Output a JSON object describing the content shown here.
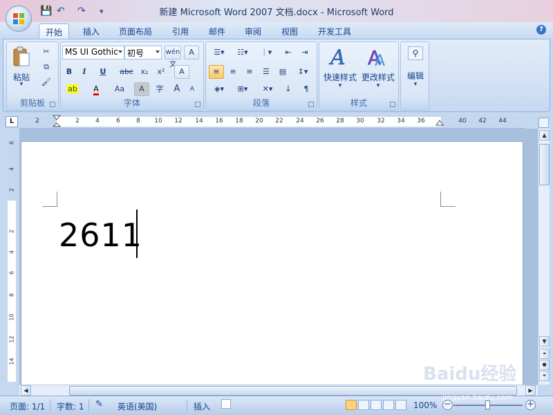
{
  "window": {
    "title": "新建 Microsoft Word 2007 文档.docx - Microsoft Word"
  },
  "qat": {
    "save": "💾",
    "undo": "↶",
    "redo": "↷",
    "customize": "▾"
  },
  "tabs": [
    "开始",
    "插入",
    "页面布局",
    "引用",
    "邮件",
    "审阅",
    "视图",
    "开发工具"
  ],
  "help": "?",
  "clipboard": {
    "paste_label": "粘贴",
    "group_label": "剪贴板"
  },
  "font": {
    "name": "MS UI Gothic",
    "size": "初号",
    "group_label": "字体",
    "bold": "B",
    "italic": "I",
    "underline": "U",
    "strike": "abc",
    "sub": "x₂",
    "sup": "x²",
    "phonetic": "wén 文",
    "border_char": "A",
    "clear": "A",
    "highlight": "ab",
    "color": "A",
    "case": "Aa",
    "shade": "A",
    "enclose": "字",
    "grow": "A",
    "shrink": "A"
  },
  "paragraph": {
    "group_label": "段落"
  },
  "styles": {
    "quick_label": "快速样式",
    "change_label": "更改样式",
    "group_label": "样式"
  },
  "editing": {
    "label": "编辑"
  },
  "ruler": {
    "corner": "L",
    "ticks": [
      "2",
      "2",
      "4",
      "6",
      "8",
      "10",
      "12",
      "14",
      "16",
      "18",
      "20",
      "22",
      "24",
      "26",
      "28",
      "30",
      "32",
      "34",
      "36",
      "40",
      "42",
      "44"
    ],
    "vticks": [
      "6",
      "4",
      "2",
      "2",
      "4",
      "6",
      "8",
      "10",
      "12",
      "14"
    ]
  },
  "document": {
    "text": "2611"
  },
  "status": {
    "page": "页面: 1/1",
    "words": "字数: 1",
    "language": "英语(美国)",
    "mode": "插入",
    "zoom": "100%"
  },
  "watermark": {
    "logo": "Baidu经验",
    "url": "jingyan.baidu.com"
  },
  "colors": {
    "accent": "#15428b",
    "ribbon": "#d3e2f5",
    "highlight_yellow": "#ffff00",
    "font_red": "#ff0000"
  }
}
